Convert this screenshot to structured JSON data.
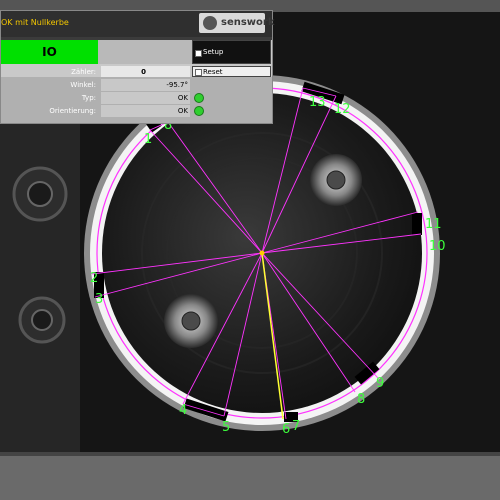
{
  "window": {
    "title": "OK mit Nullkerbe",
    "brand": "senswork"
  },
  "status": {
    "result": "IO",
    "result_color": "#00e000"
  },
  "buttons": {
    "setup": "Setup",
    "reset": "Reset"
  },
  "fields": {
    "counter_label": "Zähler:",
    "counter_value": "0",
    "angle_label": "Winkel:",
    "angle_value": "-95.7°",
    "type_label": "Typ:",
    "type_value": "OK",
    "orientation_label": "Orientierung:",
    "orientation_value": "OK"
  },
  "overlay": {
    "line_color": "#ff33ff",
    "highlight_color": "#ffff33",
    "label_color": "#3dff3d",
    "labels": [
      "1",
      "2",
      "3",
      "4",
      "5",
      "6",
      "7",
      "8",
      "9",
      "10",
      "11",
      "12",
      "13"
    ]
  }
}
